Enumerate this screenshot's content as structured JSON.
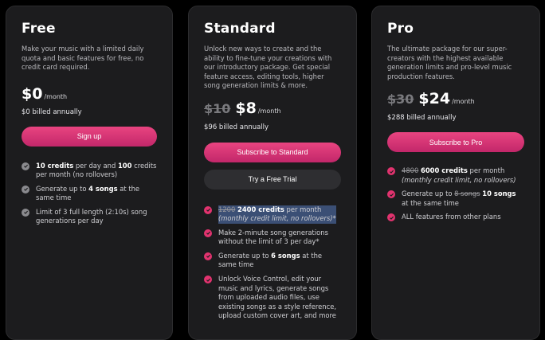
{
  "plans": {
    "free": {
      "name": "Free",
      "description": "Make your music with a limited daily quota and basic features for free, no credit card required.",
      "price": "$0",
      "per": "/month",
      "billed": "$0 billed annually",
      "cta": "Sign up",
      "features": [
        {
          "bold1": "10 credits",
          "t1": " per day and ",
          "bold2": "100",
          "t2": " credits per month (no rollovers)"
        },
        {
          "t1": "Generate up to ",
          "bold1": "4 songs",
          "t2": " at the same time"
        },
        {
          "t1": "Limit of 3 full length (2:10s) song generations per day"
        }
      ]
    },
    "standard": {
      "name": "Standard",
      "description": "Unlock new ways to create and the ability to fine-tune your creations with our introductory package. Get special feature access, editing tools, higher song generation limits & more.",
      "price_old": "$10",
      "price": "$8",
      "per": "/month",
      "billed": "$96 billed annually",
      "cta": "Subscribe to Standard",
      "cta_secondary": "Try a Free Trial",
      "features": [
        {
          "strike": "1200",
          "bold1": "2400 credits",
          "t1": " per month",
          "note": "(monthly credit limit, no rollovers)*"
        },
        {
          "t1": "Make 2-minute song generations without the limit of 3 per day*"
        },
        {
          "t1": "Generate up to ",
          "bold1": "6 songs",
          "t2": " at the same time"
        },
        {
          "t1": "Unlock Voice Control, edit your music and lyrics, generate songs from uploaded audio files, use existing songs as a style reference, upload custom cover art, and more"
        }
      ]
    },
    "pro": {
      "name": "Pro",
      "description": "The ultimate package for our super-creators with the highest available generation limits and pro-level music production features.",
      "price_old": "$30",
      "price": "$24",
      "per": "/month",
      "billed": "$288 billed annually",
      "cta": "Subscribe to Pro",
      "features": [
        {
          "strike": "4800",
          "bold1": "6000 credits",
          "t1": " per month",
          "note": "(monthly credit limit, no rollovers)"
        },
        {
          "t1": "Generate up to ",
          "strike": "8 songs",
          "bold1": "10 songs",
          "t2": " at the same time"
        },
        {
          "t1": "ALL features from other plans"
        }
      ]
    }
  },
  "colors": {
    "accent": "#e2336f",
    "card": "#1c1c1e",
    "check_grey": "#8a8a8e"
  }
}
